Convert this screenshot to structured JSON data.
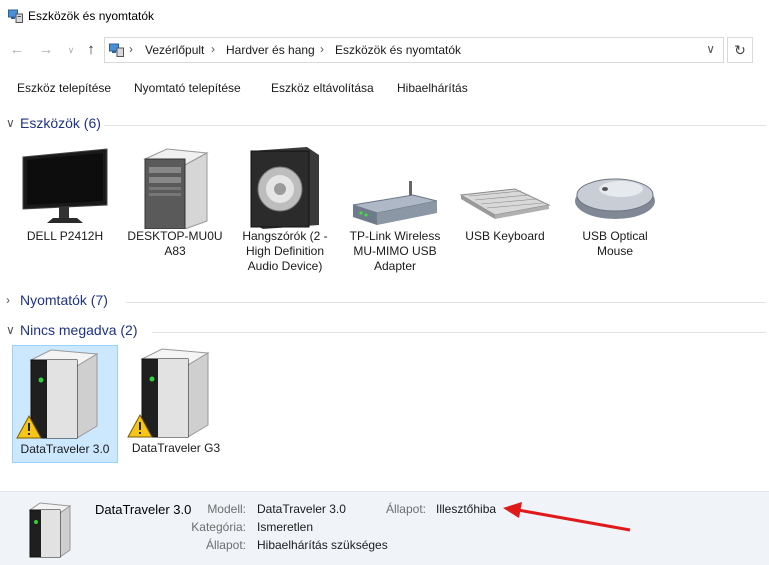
{
  "window": {
    "title": "Eszközök és nyomtatók"
  },
  "address_bar": {
    "breadcrumbs": [
      "Vezérlőpult",
      "Hardver és hang",
      "Eszközök és nyomtatók"
    ]
  },
  "toolbar": {
    "commands": [
      "Eszköz telepítése",
      "Nyomtató telepítése",
      "Eszköz eltávolítása",
      "Hibaelhárítás"
    ]
  },
  "groups": {
    "devices": {
      "title": "Eszközök (6)",
      "items": [
        {
          "label": "DELL P2412H",
          "icon": "monitor-icon"
        },
        {
          "label": "DESKTOP-MU0U A83",
          "icon": "computer-tower-icon"
        },
        {
          "label": "Hangszórók (2 - High Definition Audio Device)",
          "icon": "speaker-icon"
        },
        {
          "label": "TP-Link Wireless MU-MIMO USB Adapter",
          "icon": "network-adapter-icon"
        },
        {
          "label": "USB Keyboard",
          "icon": "keyboard-icon"
        },
        {
          "label": "USB Optical Mouse",
          "icon": "mouse-icon"
        }
      ]
    },
    "printers": {
      "title": "Nyomtatók (7)"
    },
    "unspecified": {
      "title": "Nincs megadva (2)",
      "items": [
        {
          "label": "DataTraveler 3.0",
          "icon": "usb-drive-warning-icon",
          "selected": true
        },
        {
          "label": "DataTraveler G3",
          "icon": "usb-drive-warning-icon",
          "selected": false
        }
      ]
    }
  },
  "details": {
    "name": "DataTraveler 3.0",
    "model_label": "Modell:",
    "model_value": "DataTraveler 3.0",
    "state_label": "Állapot:",
    "state_value": "Illesztőhiba",
    "category_label": "Kategória:",
    "category_value": "Ismeretlen",
    "status_label": "Állapot:",
    "status_value": "Hibaelhárítás szükséges"
  },
  "colors": {
    "group_header": "#1e3287",
    "selection": "#cce8ff",
    "details_background": "#f0f4f9",
    "annotation_arrow": "#e0191b"
  }
}
